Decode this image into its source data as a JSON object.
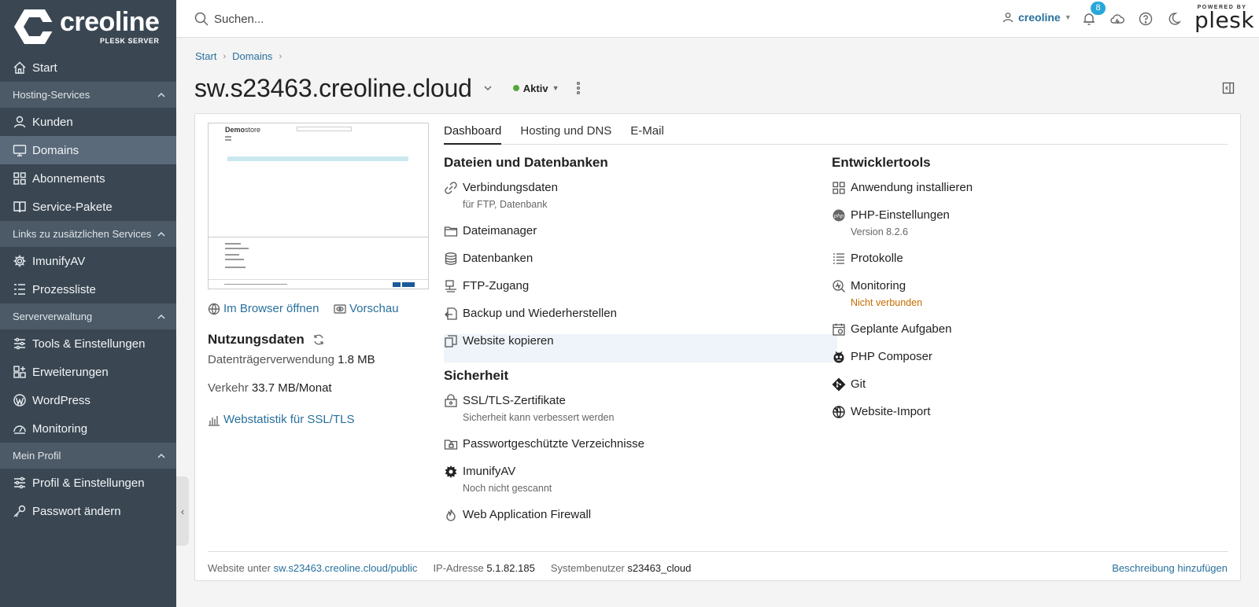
{
  "brand": {
    "name": "creoline",
    "sub": "PLESK SERVER",
    "powered_small": "POWERED BY",
    "powered_brand": "plesk"
  },
  "sidebar": {
    "items": [
      {
        "label": "Start",
        "icon": "home-icon"
      },
      {
        "section": "Hosting-Services"
      },
      {
        "label": "Kunden",
        "icon": "user-icon"
      },
      {
        "label": "Domains",
        "icon": "monitor-icon",
        "active": true
      },
      {
        "label": "Abonnements",
        "icon": "grid-icon"
      },
      {
        "label": "Service-Pakete",
        "icon": "book-icon"
      },
      {
        "section": "Links zu zusätzlichen Services"
      },
      {
        "label": "ImunifyAV",
        "icon": "gear-icon"
      },
      {
        "label": "Prozessliste",
        "icon": "list-icon"
      },
      {
        "section": "Serververwaltung"
      },
      {
        "label": "Tools & Einstellungen",
        "icon": "sliders-icon"
      },
      {
        "label": "Erweiterungen",
        "icon": "extensions-icon"
      },
      {
        "label": "WordPress",
        "icon": "wordpress-icon"
      },
      {
        "label": "Monitoring",
        "icon": "gauge-icon"
      },
      {
        "section": "Mein Profil"
      },
      {
        "label": "Profil & Einstellungen",
        "icon": "profile-icon"
      },
      {
        "label": "Passwort ändern",
        "icon": "key-icon"
      }
    ]
  },
  "topbar": {
    "search_placeholder": "Suchen...",
    "user": "creoline",
    "notification_count": "8"
  },
  "breadcrumb": [
    "Start",
    "Domains"
  ],
  "page": {
    "title": "sw.s23463.creoline.cloud",
    "status": "Aktiv"
  },
  "preview": {
    "thumb_logo_bold": "Demo",
    "thumb_logo_rest": "store",
    "open_browser": "Im Browser öffnen",
    "preview": "Vorschau"
  },
  "usage": {
    "title": "Nutzungsdaten",
    "disk_label": "Datenträgerverwendung",
    "disk_value": "1.8 MB",
    "traffic_label": "Verkehr",
    "traffic_value": "33.7 MB/Monat",
    "webstat": "Webstatistik für SSL/TLS"
  },
  "tabs": [
    "Dashboard",
    "Hosting und DNS",
    "E-Mail"
  ],
  "files": {
    "title": "Dateien und Datenbanken",
    "items": [
      {
        "label": "Verbindungsdaten",
        "sub": "für FTP, Datenbank"
      },
      {
        "label": "Dateimanager"
      },
      {
        "label": "Datenbanken"
      },
      {
        "label": "FTP-Zugang"
      },
      {
        "label": "Backup und Wiederherstellen"
      },
      {
        "label": "Website kopieren"
      }
    ]
  },
  "security": {
    "title": "Sicherheit",
    "items": [
      {
        "label": "SSL/TLS-Zertifikate",
        "sub": "Sicherheit kann verbessert werden"
      },
      {
        "label": "Passwortgeschützte Verzeichnisse"
      },
      {
        "label": "ImunifyAV",
        "sub": "Noch nicht gescannt"
      },
      {
        "label": "Web Application Firewall"
      }
    ]
  },
  "dev": {
    "title": "Entwicklertools",
    "items": [
      {
        "label": "Anwendung installieren"
      },
      {
        "label": "PHP-Einstellungen",
        "sub": "Version 8.2.6"
      },
      {
        "label": "Protokolle"
      },
      {
        "label": "Monitoring",
        "sub": "Nicht verbunden"
      },
      {
        "label": "Geplante Aufgaben"
      },
      {
        "label": "PHP Composer"
      },
      {
        "label": "Git"
      },
      {
        "label": "Website-Import"
      }
    ]
  },
  "footer": {
    "site_label": "Website unter",
    "site_url": "sw.s23463.creoline.cloud/public",
    "ip_label": "IP-Adresse",
    "ip_value": "5.1.82.185",
    "user_label": "Systembenutzer",
    "user_value": "s23463_cloud",
    "add_desc": "Beschreibung hinzufügen"
  },
  "colors": {
    "sidebar_bg": "#3a4753",
    "sidebar_active": "#5a6a7a",
    "section_bg": "#4c5a67",
    "link": "#28709c",
    "status_green": "#52a838",
    "warning": "#c56c00",
    "badge": "#28a8d8"
  }
}
